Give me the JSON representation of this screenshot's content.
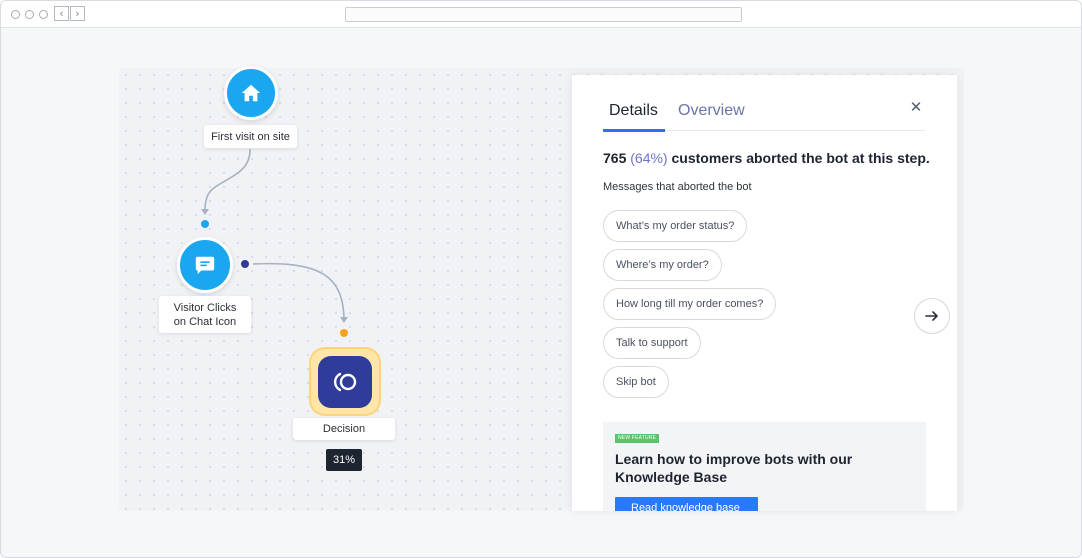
{
  "browser": {
    "back_icon": "chevron-left-icon",
    "forward_icon": "chevron-right-icon"
  },
  "flow": {
    "nodes": [
      {
        "label": "First visit on site",
        "icon": "home-icon"
      },
      {
        "label": "Visitor Clicks\non Chat Icon",
        "icon": "chat-bubble-icon"
      },
      {
        "label": "Decision",
        "icon": "decision-logo-icon",
        "percent": "31%"
      }
    ]
  },
  "panel": {
    "tabs": [
      {
        "label": "Details",
        "active": true
      },
      {
        "label": "Overview",
        "active": false
      }
    ],
    "close_icon": "close-icon",
    "headline": {
      "count": "765",
      "percent": "(64%)",
      "text": "customers aborted the bot at this step."
    },
    "subheading": "Messages that aborted the bot",
    "messages": [
      "What’s my order status?",
      "Where’s my order?",
      "How long till my order comes?",
      "Talk to support",
      "Skip bot"
    ],
    "promo": {
      "badge": "NEW FEATURE",
      "title": "Learn how to improve bots with our Knowledge Base",
      "button": "Read knowledge base"
    }
  },
  "next_button_icon": "arrow-right-icon",
  "colors": {
    "accent": "#2f6ef2",
    "node_blue": "#1aa7f0",
    "decision": "#2f3c9a",
    "decision_glow": "#ffe5a8",
    "new_badge": "#5bc46a"
  }
}
